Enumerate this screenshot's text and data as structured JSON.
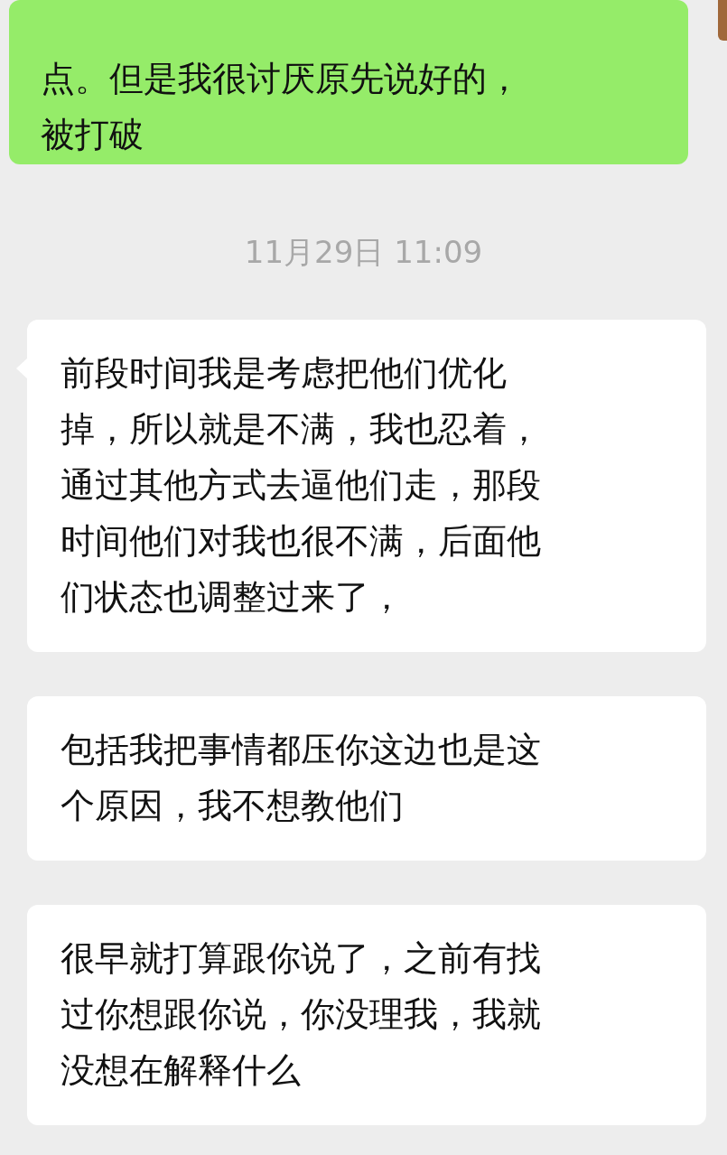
{
  "messages": [
    {
      "kind": "sent",
      "tail": false,
      "lines": [
        "点。但是我很讨厌原先说好的，",
        "被打破"
      ]
    },
    {
      "kind": "time",
      "text": "11月29日 11:09"
    },
    {
      "kind": "received",
      "tail": true,
      "lines": [
        "前段时间我是考虑把他们优化",
        "掉，所以就是不满，我也忍着，",
        "通过其他方式去逼他们走，那段",
        "时间他们对我也很不满，后面他",
        "们状态也调整过来了，"
      ]
    },
    {
      "kind": "received",
      "tail": false,
      "lines": [
        "包括我把事情都压你这边也是这",
        "个原因，我不想教他们"
      ]
    },
    {
      "kind": "received",
      "tail": false,
      "lines": [
        "很早就打算跟你说了，之前有找",
        "过你想跟你说，你没理我，我就",
        "没想在解释什么"
      ]
    }
  ]
}
